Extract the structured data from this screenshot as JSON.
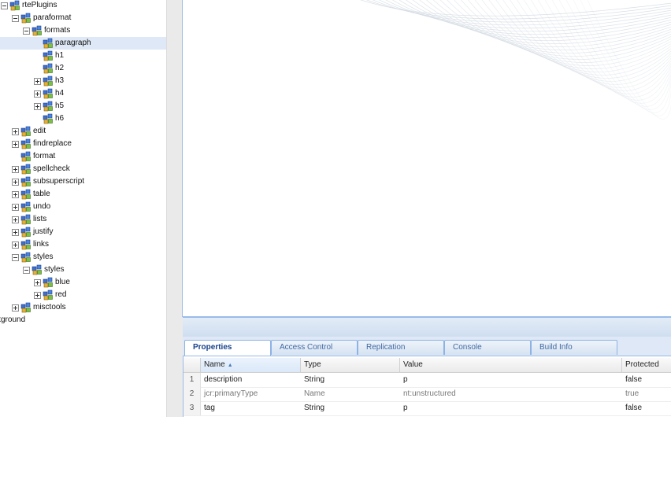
{
  "tree": {
    "nodes": [
      {
        "label": "rtePlugins",
        "indent": 0,
        "expander": "minus"
      },
      {
        "label": "paraformat",
        "indent": 1,
        "expander": "minus"
      },
      {
        "label": "formats",
        "indent": 2,
        "expander": "minus"
      },
      {
        "label": "paragraph",
        "indent": 3,
        "expander": "none",
        "selected": true
      },
      {
        "label": "h1",
        "indent": 3,
        "expander": "none"
      },
      {
        "label": "h2",
        "indent": 3,
        "expander": "none"
      },
      {
        "label": "h3",
        "indent": 3,
        "expander": "plus"
      },
      {
        "label": "h4",
        "indent": 3,
        "expander": "plus"
      },
      {
        "label": "h5",
        "indent": 3,
        "expander": "plus"
      },
      {
        "label": "h6",
        "indent": 3,
        "expander": "none"
      },
      {
        "label": "edit",
        "indent": 1,
        "expander": "plus"
      },
      {
        "label": "findreplace",
        "indent": 1,
        "expander": "plus"
      },
      {
        "label": "format",
        "indent": 1,
        "expander": "none"
      },
      {
        "label": "spellcheck",
        "indent": 1,
        "expander": "plus"
      },
      {
        "label": "subsuperscript",
        "indent": 1,
        "expander": "plus"
      },
      {
        "label": "table",
        "indent": 1,
        "expander": "plus"
      },
      {
        "label": "undo",
        "indent": 1,
        "expander": "plus"
      },
      {
        "label": "lists",
        "indent": 1,
        "expander": "plus"
      },
      {
        "label": "justify",
        "indent": 1,
        "expander": "plus"
      },
      {
        "label": "links",
        "indent": 1,
        "expander": "plus"
      },
      {
        "label": "styles",
        "indent": 1,
        "expander": "minus"
      },
      {
        "label": "styles",
        "indent": 2,
        "expander": "minus"
      },
      {
        "label": "blue",
        "indent": 3,
        "expander": "plus"
      },
      {
        "label": "red",
        "indent": 3,
        "expander": "plus"
      },
      {
        "label": "misctools",
        "indent": 1,
        "expander": "plus"
      },
      {
        "label": "kground",
        "indent": -1,
        "expander": "none",
        "no_icon": true
      }
    ]
  },
  "tabs": [
    {
      "label": "Properties",
      "active": true
    },
    {
      "label": "Access Control",
      "active": false
    },
    {
      "label": "Replication",
      "active": false
    },
    {
      "label": "Console",
      "active": false
    },
    {
      "label": "Build Info",
      "active": false
    }
  ],
  "grid": {
    "columns": [
      "Name",
      "Type",
      "Value",
      "Protected"
    ],
    "sort_indicator": "▲",
    "rows": [
      {
        "num": "1",
        "name": "description",
        "type": "String",
        "value": "p",
        "protected": "false"
      },
      {
        "num": "2",
        "name": "jcr:primaryType",
        "type": "Name",
        "value": "nt:unstructured",
        "protected": "true",
        "dim": true
      },
      {
        "num": "3",
        "name": "tag",
        "type": "String",
        "value": "p",
        "protected": "false"
      }
    ]
  },
  "colors": {
    "accent": "#15428b",
    "border": "#99bbe8",
    "selected_row": "#dfe8f6",
    "wave": "#d4dbe3"
  },
  "icons": {
    "node": "jcr-node-icon",
    "expand": "plus-expander-icon",
    "collapse": "minus-expander-icon"
  }
}
